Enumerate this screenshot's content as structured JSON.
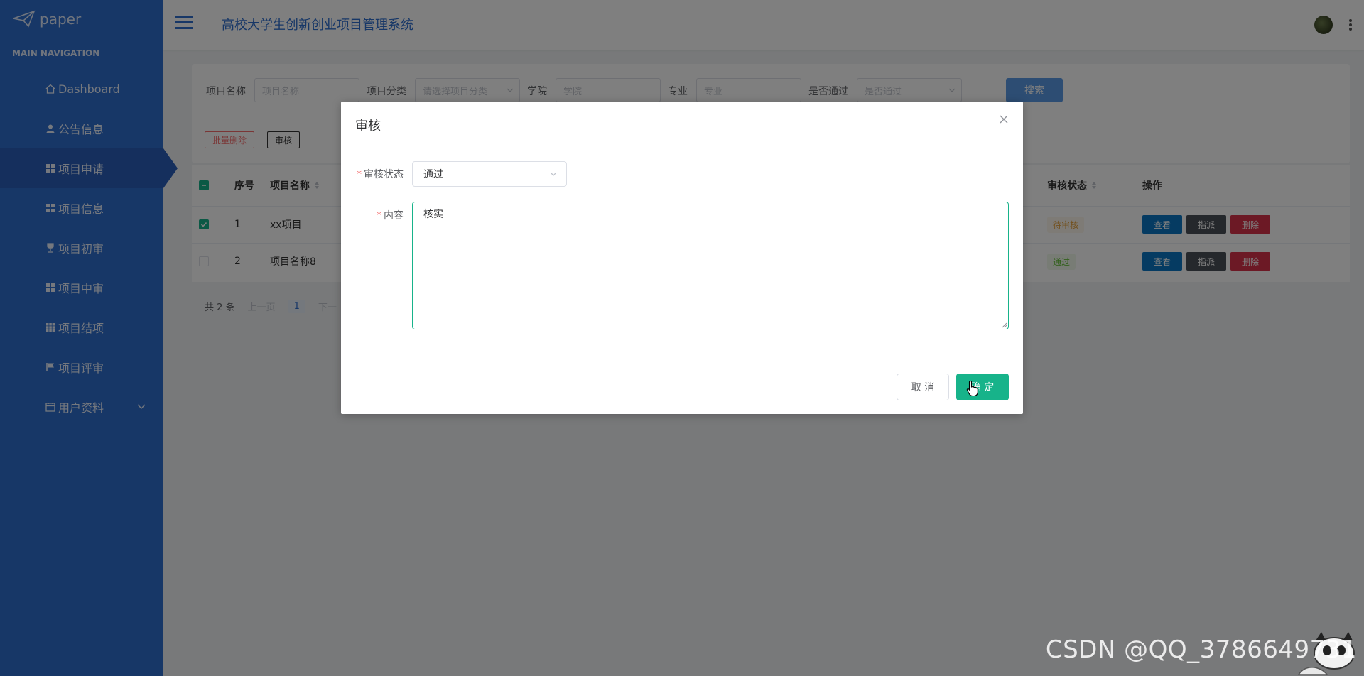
{
  "sidebar": {
    "logo_text": "paper",
    "nav_heading": "MAIN NAVIGATION",
    "items": [
      {
        "label": "Dashboard",
        "icon": "home-icon"
      },
      {
        "label": "公告信息",
        "icon": "user-icon"
      },
      {
        "label": "项目申请",
        "icon": "grid-icon",
        "active": true
      },
      {
        "label": "项目信息",
        "icon": "grid-icon"
      },
      {
        "label": "项目初审",
        "icon": "trophy-icon"
      },
      {
        "label": "项目中审",
        "icon": "grid-icon"
      },
      {
        "label": "项目结项",
        "icon": "table-icon"
      },
      {
        "label": "项目评审",
        "icon": "flag-icon"
      },
      {
        "label": "用户资料",
        "icon": "calendar-icon",
        "expandable": true
      }
    ]
  },
  "header": {
    "title": "高校大学生创新创业项目管理系统"
  },
  "search": {
    "fields": [
      {
        "label": "项目名称",
        "placeholder": "项目名称"
      },
      {
        "label": "项目分类",
        "placeholder": "请选择项目分类"
      },
      {
        "label": "学院",
        "placeholder": "学院"
      },
      {
        "label": "专业",
        "placeholder": "专业"
      },
      {
        "label": "是否通过",
        "placeholder": "是否通过"
      }
    ],
    "search_button": "搜索",
    "batch_delete": "批量删除",
    "audit_button": "审核"
  },
  "table": {
    "columns": {
      "index": "序号",
      "name": "项目名称",
      "status": "审核状态",
      "actions": "操作"
    },
    "rows": [
      {
        "index": "1",
        "name": "xx项目",
        "status": "待审核",
        "checked": true
      },
      {
        "index": "2",
        "name": "项目名称8",
        "status": "通过",
        "checked": false
      }
    ],
    "actions": {
      "view": "查看",
      "assign": "指派",
      "delete": "删除"
    }
  },
  "pagination": {
    "total": "共 2 条",
    "prev": "上一页",
    "page": "1",
    "next": "下一"
  },
  "dialog": {
    "title": "审核",
    "status_label": "审核状态",
    "status_value": "通过",
    "content_label": "内容",
    "content_value": "核实",
    "cancel": "取 消",
    "confirm": "确 定"
  },
  "watermark": "CSDN @QQ_3786649731",
  "colors": {
    "sidebar": "#2f6fcf",
    "primary": "#17b38a",
    "danger": "#d9334a",
    "view": "#0a76c4",
    "assign": "#4a5058"
  }
}
